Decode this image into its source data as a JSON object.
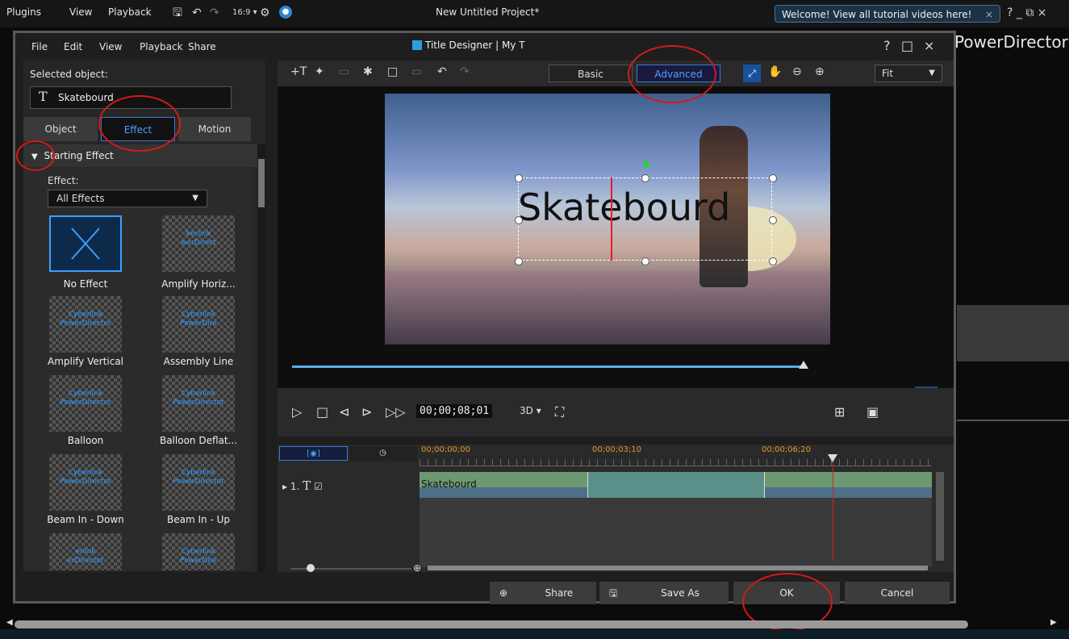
{
  "appbar": {
    "menus": [
      "Plugins",
      "View",
      "Playback"
    ],
    "aspect": "16:9",
    "project_title": "New Untitled Project*",
    "welcome": "Welcome! View all tutorial videos here!",
    "right_icons": "? _ ⧉ ×"
  },
  "background": {
    "app_name": "PowerDirector"
  },
  "dialog": {
    "menus": [
      "File",
      "Edit",
      "View",
      "Playback",
      "Share"
    ],
    "title": "Title Designer | My T",
    "window_controls": [
      "?",
      "□",
      "×"
    ],
    "selected_object_label": "Selected object:",
    "selected_object_name": "Skatebourd",
    "tabs": [
      "Object",
      "Effect",
      "Motion"
    ],
    "active_tab": "Effect",
    "starting_effect": "Starting Effect",
    "effect_label": "Effect:",
    "effect_filter": "All Effects",
    "effects": [
      {
        "name": "No Effect",
        "thumb": "x-icon"
      },
      {
        "name": "Amplify Horiz...",
        "thumb": "berlink\nwerDirect"
      },
      {
        "name": "Amplify Vertical",
        "thumb": "Cyberlink\nPowerDirector"
      },
      {
        "name": "Assembly Line",
        "thumb": "Cyberlink\nPowerDire"
      },
      {
        "name": "Balloon",
        "thumb": "Cyberlink\nPowerDirector"
      },
      {
        "name": "Balloon Deflat...",
        "thumb": "Cyberlink\nPowerDirector"
      },
      {
        "name": "Beam In - Down",
        "thumb": "Cyberlink\nPowerDirector"
      },
      {
        "name": "Beam In - Up",
        "thumb": "Cyberlink\nPowerDirector"
      },
      {
        "name": "",
        "thumb": "erlink\nerDirector"
      },
      {
        "name": "",
        "thumb": "Cyberlink\nPowerDire"
      }
    ],
    "toolbar": {
      "basic": "Basic",
      "advanced": "Advanced",
      "fit": "Fit"
    },
    "preview_text": "Skatebourd",
    "timecode": "00;00;08;01",
    "three_d": "3D",
    "timeline": {
      "times": [
        "00;00;00;00",
        "00;00;03;10",
        "00;00;06;20"
      ],
      "track_number": "1.",
      "clip_label": "Skatebourd"
    },
    "buttons": {
      "share": "Share",
      "save_as": "Save As",
      "ok": "OK",
      "cancel": "Cancel"
    }
  },
  "colors": {
    "accent": "#3b7bd4",
    "annotation": "#d81818",
    "playhead": "#d02020"
  }
}
